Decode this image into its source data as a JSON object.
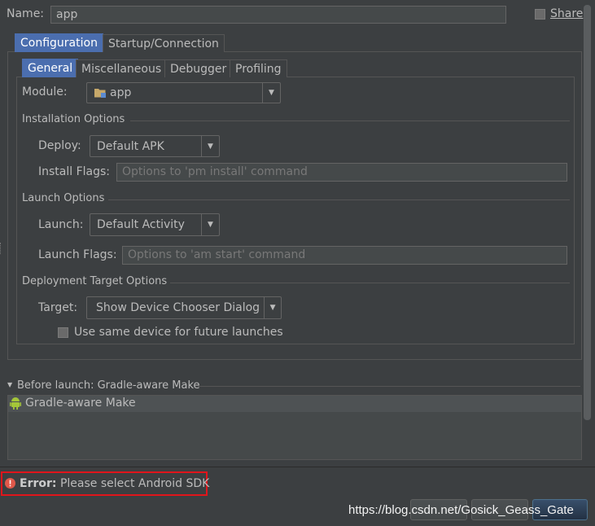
{
  "name_label": "Name:",
  "name_value": "app",
  "share_label": "Share",
  "outer_tabs": [
    "Configuration",
    "Startup/Connection"
  ],
  "inner_tabs": [
    "General",
    "Miscellaneous",
    "Debugger",
    "Profiling"
  ],
  "module": {
    "label": "Module:",
    "value": "app"
  },
  "installation": {
    "title": "Installation Options",
    "deploy_label": "Deploy:",
    "deploy_value": "Default APK",
    "install_flags_label": "Install Flags:",
    "install_flags_placeholder": "Options to 'pm install' command"
  },
  "launch": {
    "title": "Launch Options",
    "launch_label": "Launch:",
    "launch_value": "Default Activity",
    "launch_flags_label": "Launch Flags:",
    "launch_flags_placeholder": "Options to 'am start' command"
  },
  "deployment": {
    "title": "Deployment Target Options",
    "target_label": "Target:",
    "target_value": "Show Device Chooser Dialog",
    "same_device_label": "Use same device for future launches"
  },
  "before_launch": {
    "title": "Before launch: Gradle-aware Make",
    "items": [
      "Gradle-aware Make"
    ]
  },
  "error": {
    "prefix": "Error:",
    "message": "Please select Android SDK"
  },
  "watermark": "https://blog.csdn.net/Gosick_Geass_Gate",
  "colors": {
    "accent": "#4b6eaf",
    "error_border": "#e0151b",
    "error_icon": "#e0584a",
    "android_green": "#a4c639"
  }
}
